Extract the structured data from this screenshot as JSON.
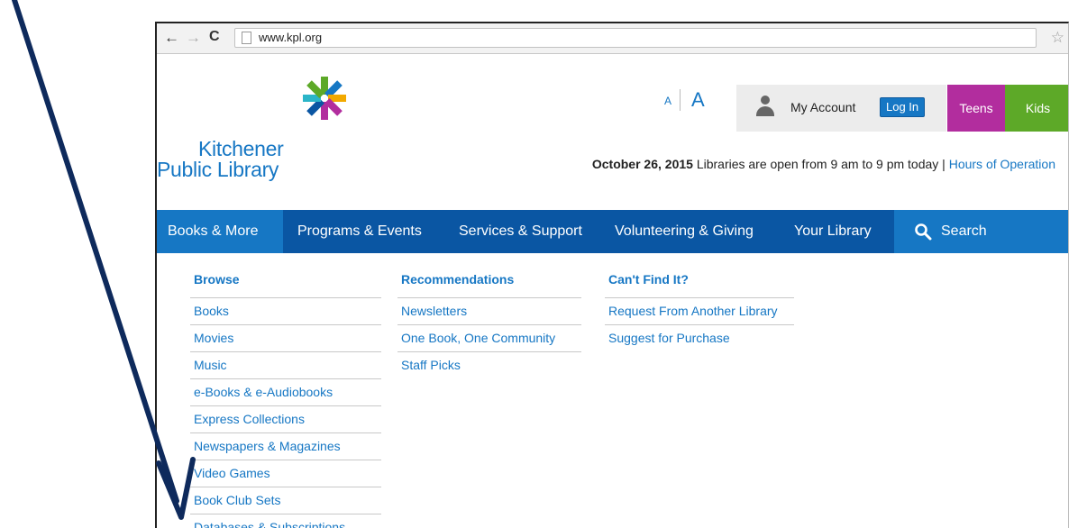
{
  "browser": {
    "back": "←",
    "forward": "→",
    "reload": "C",
    "url": "www.kpl.org",
    "star": "☆"
  },
  "site": {
    "logo_line1": "Kitchener",
    "logo_line2": "Public Library",
    "text_size_small": "A",
    "text_size_large": "A",
    "my_account": "My Account",
    "login": "Log In",
    "teens": "Teens",
    "kids": "Kids",
    "date": "October 26, 2015",
    "hours_text": "Libraries are open from 9 am to 9 pm today",
    "separator": "|",
    "hours_link": "Hours of Operation"
  },
  "nav": {
    "items": [
      "Books & More",
      "Programs & Events",
      "Services & Support",
      "Volunteering & Giving",
      "Your Library"
    ],
    "search": "Search"
  },
  "menu": {
    "browse": {
      "heading": "Browse",
      "items": [
        "Books",
        "Movies",
        "Music",
        "e-Books & e-Audiobooks",
        "Express Collections",
        "Newspapers & Magazines",
        "Video Games",
        "Book Club Sets",
        "Databases & Subscriptions"
      ]
    },
    "recommendations": {
      "heading": "Recommendations",
      "items": [
        "Newsletters",
        "One Book, One Community",
        "Staff Picks"
      ]
    },
    "cant_find": {
      "heading": "Can't Find It?",
      "items": [
        "Request From Another Library",
        "Suggest for Purchase"
      ]
    }
  },
  "colors": {
    "link_blue": "#1677c4",
    "nav_blue": "#0a56a3",
    "teens": "#b22d9e",
    "kids": "#5da928",
    "arrow": "#0e2a5c"
  }
}
